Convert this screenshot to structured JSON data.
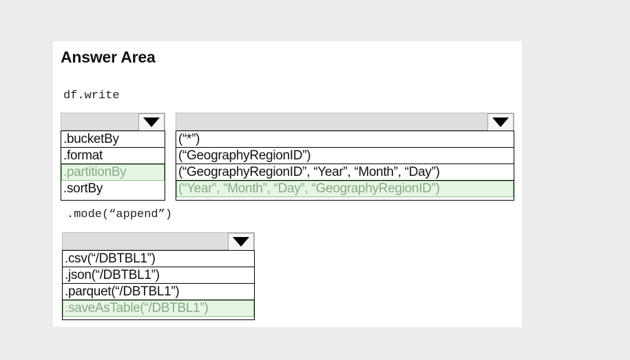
{
  "title": "Answer Area",
  "code": {
    "line1": "df.write",
    "line2": ".mode(“append”)"
  },
  "dropdown1": {
    "selected_option": ".partitionBy",
    "options": [
      ".bucketBy",
      ".format",
      ".partitionBy",
      ".sortBy"
    ]
  },
  "dropdown2": {
    "selected_option": "(“Year”, “Month”, “Day”, “GeographyRegionID”)",
    "options": [
      "(“*”)",
      "(“GeographyRegionID”)",
      "(“GeographyRegionID”, “Year”, “Month”, “Day”)",
      "(“Year”, “Month”, “Day”, “GeographyRegionID”)"
    ]
  },
  "dropdown3": {
    "selected_option": ".saveAsTable(“/DBTBL1”)",
    "options": [
      ".csv(“/DBTBL1”)",
      ".json(“/DBTBL1”)",
      ".parquet(“/DBTBL1”)",
      ".saveAsTable(“/DBTBL1”)"
    ]
  },
  "colors": {
    "page_background": "#ececec",
    "panel_background": "#ffffff",
    "dropdown_header": "#dedede",
    "selected_fill": "#e7f6e4",
    "selected_text": "#8aa888",
    "selected_border": "#8cc088"
  },
  "icons": {
    "dropdown_arrow": "caret-down-icon"
  }
}
